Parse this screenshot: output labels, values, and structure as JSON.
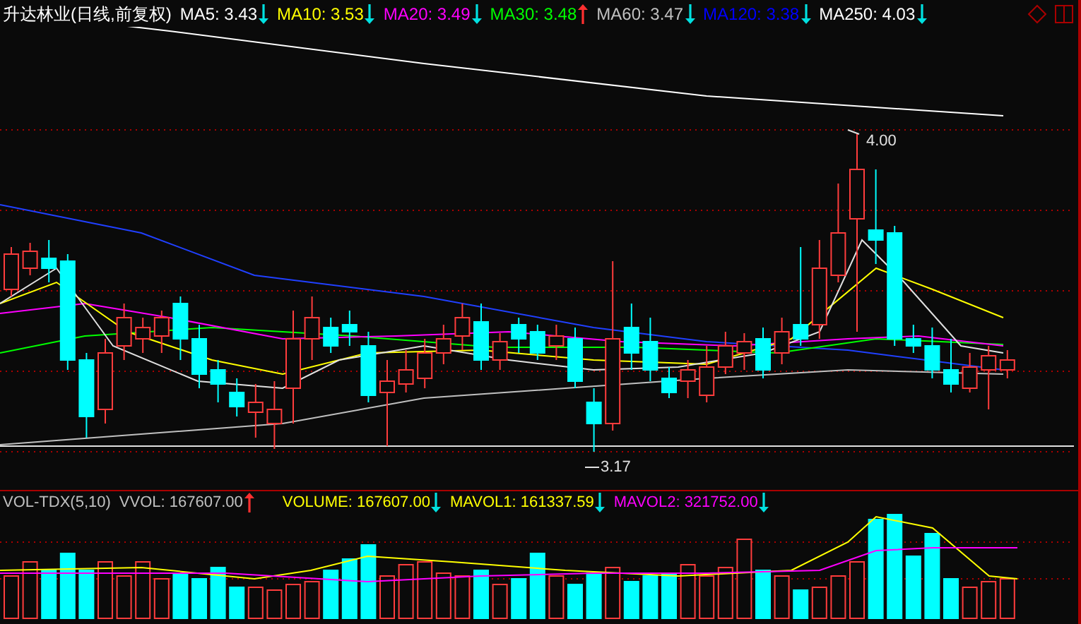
{
  "title": "升达林业(日线,前复权)",
  "indicators": [
    {
      "label": "MA5: 3.43",
      "color": "#ffffff",
      "rising": false
    },
    {
      "label": "MA10: 3.53",
      "color": "#ffff00",
      "rising": false
    },
    {
      "label": "MA20: 3.49",
      "color": "#ff00ff",
      "rising": false
    },
    {
      "label": "MA30: 3.48",
      "color": "#00ff00",
      "rising": true
    },
    {
      "label": "MA60: 3.47",
      "color": "#c0c0c0",
      "rising": false
    },
    {
      "label": "MA120: 3.38",
      "color": "#0000ff",
      "rising": false
    },
    {
      "label": "MA250: 4.03",
      "color": "#ffffff",
      "rising": false
    }
  ],
  "high_label": "4.00",
  "low_label": "3.17",
  "volume": {
    "title": "VOL-TDX(5,10)",
    "indicators": [
      {
        "label": "VVOL: 167607.00",
        "color": "#c0c0c0",
        "rising": true
      },
      {
        "label": "VOLUME: 167607.00",
        "color": "#ffff00",
        "rising": false
      },
      {
        "label": "MAVOL1: 161337.59",
        "color": "#ffff00",
        "rising": false
      },
      {
        "label": "MAVOL2: 321752.00",
        "color": "#ff00ff",
        "rising": false
      }
    ]
  }
}
